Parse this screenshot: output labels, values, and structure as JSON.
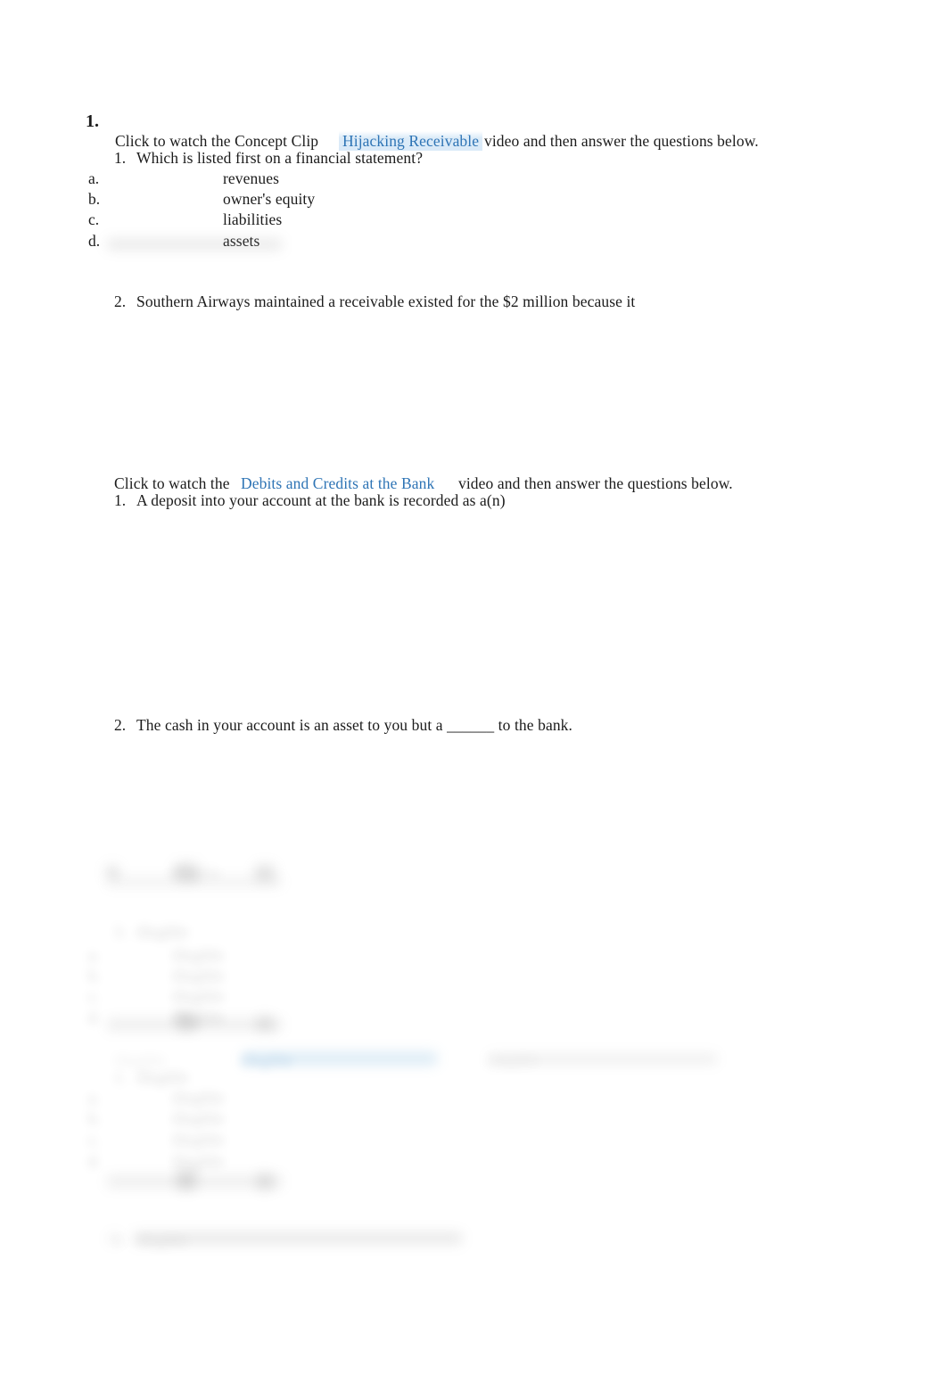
{
  "document": {
    "title": "Accounting Concept Clip Worksheet",
    "link_color": "#2e74b5",
    "text_color": "#1b1b1b",
    "highlight_color": "#d6e8f7"
  },
  "section_1": {
    "outer_number": "1.",
    "intro_before": "Click to watch the Concept Clip",
    "intro_link": "Hijacking Receivable",
    "intro_after": "video and then answer the questions below.",
    "question_1": {
      "number": "1.",
      "text": "Which is listed first on a financial statement?",
      "choices": [
        {
          "marker": "a.",
          "text": "revenues"
        },
        {
          "marker": "b.",
          "text": "owner's equity"
        },
        {
          "marker": "c.",
          "text": "liabilities"
        },
        {
          "marker": "d.",
          "text": "assets"
        }
      ]
    },
    "question_2": {
      "number": "2.",
      "text": "Southern Airways maintained a receivable existed for the $2 million because it"
    }
  },
  "section_2": {
    "intro_before": "Click to watch the",
    "intro_link": "Debits and Credits at the Bank",
    "intro_after": "video and then answer the questions below.",
    "question_1": {
      "number": "1.",
      "text": "A deposit into your account at the bank is recorded as a(n)"
    },
    "question_2": {
      "number": "2.",
      "text": "The cash in your account is an asset to you but a ______ to the bank."
    }
  },
  "section_3_obscured": {
    "note": "illegible",
    "question_a": {
      "number": "3.",
      "text": "illegible",
      "choices": [
        {
          "marker": "a.",
          "text": "illegible"
        },
        {
          "marker": "b.",
          "text": "illegible"
        },
        {
          "marker": "c.",
          "text": "illegible"
        },
        {
          "marker": "d.",
          "text": "illegible"
        }
      ]
    },
    "intro_before": "illegible",
    "intro_link": "illegible",
    "intro_after": "illegible",
    "question_b": {
      "number": "1.",
      "text": "illegible",
      "choices": [
        {
          "marker": "a.",
          "text": "illegible"
        },
        {
          "marker": "b.",
          "text": "illegible"
        },
        {
          "marker": "c.",
          "text": "illegible"
        },
        {
          "marker": "d.",
          "text": "illegible"
        }
      ]
    },
    "question_c": {
      "number": "2.",
      "text": "illegible"
    }
  }
}
